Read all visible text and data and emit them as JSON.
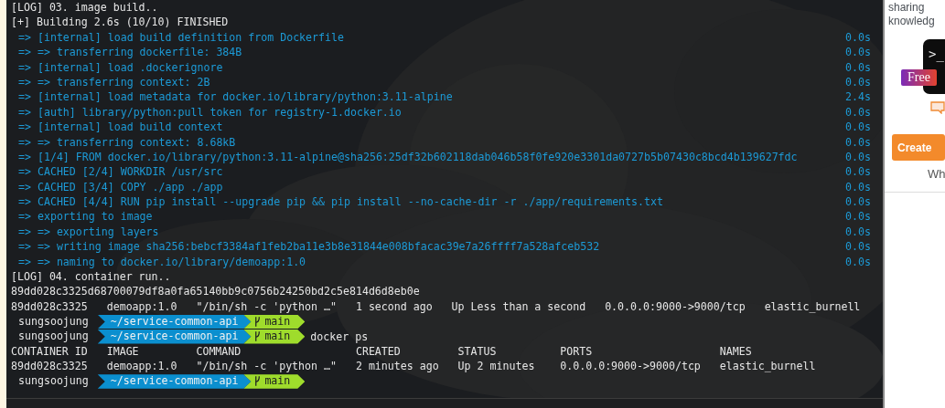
{
  "terminal": {
    "lines": [
      {
        "kind": "log",
        "text": "[LOG] 03. image build.."
      },
      {
        "kind": "log",
        "text": "[+] Building 2.6s (10/10) FINISHED"
      },
      {
        "kind": "step",
        "text": "=> [internal] load build definition from Dockerfile",
        "time": "0.0s"
      },
      {
        "kind": "step",
        "text": "=> => transferring dockerfile: 384B",
        "time": "0.0s"
      },
      {
        "kind": "step",
        "text": "=> [internal] load .dockerignore",
        "time": "0.0s"
      },
      {
        "kind": "step",
        "text": "=> => transferring context: 2B",
        "time": "0.0s"
      },
      {
        "kind": "step",
        "text": "=> [internal] load metadata for docker.io/library/python:3.11-alpine",
        "time": "2.4s"
      },
      {
        "kind": "step",
        "text": "=> [auth] library/python:pull token for registry-1.docker.io",
        "time": "0.0s"
      },
      {
        "kind": "step",
        "text": "=> [internal] load build context",
        "time": "0.0s"
      },
      {
        "kind": "step",
        "text": "=> => transferring context: 8.68kB",
        "time": "0.0s"
      },
      {
        "kind": "step",
        "text": "=> [1/4] FROM docker.io/library/python:3.11-alpine@sha256:25df32b602118dab046b58f0fe920e3301da0727b5b07430c8bcd4b139627fdc",
        "time": "0.0s"
      },
      {
        "kind": "step",
        "text": "=> CACHED [2/4] WORKDIR /usr/src",
        "time": "0.0s"
      },
      {
        "kind": "step",
        "text": "=> CACHED [3/4] COPY ./app ./app",
        "time": "0.0s"
      },
      {
        "kind": "step",
        "text": "=> CACHED [4/4] RUN pip install --upgrade pip && pip install --no-cache-dir -r ./app/requirements.txt",
        "time": "0.0s"
      },
      {
        "kind": "step",
        "text": "=> exporting to image",
        "time": "0.0s"
      },
      {
        "kind": "step",
        "text": "=> => exporting layers",
        "time": "0.0s"
      },
      {
        "kind": "step",
        "text": "=> => writing image sha256:bebcf3384af1feb2ba11e3b8e31844e008bfacac39e7a26ffff7a528afceb532",
        "time": "0.0s"
      },
      {
        "kind": "step",
        "text": "=> => naming to docker.io/library/demoapp:1.0",
        "time": "0.0s"
      },
      {
        "kind": "log",
        "text": "[LOG] 04. container run.."
      },
      {
        "kind": "output",
        "text": "89dd028c3325d68700079df8a0fa65140bb9c0756b24250bd2c5e814d6d8eb0e"
      },
      {
        "kind": "output",
        "text": "89dd028c3325   demoapp:1.0   \"/bin/sh -c 'python …\"   1 second ago   Up Less than a second   0.0.0.0:9000->9000/tcp   elastic_burnell"
      },
      {
        "kind": "prompt",
        "user": "sungsoojung",
        "path": "~/service-common-api",
        "branch": "main"
      },
      {
        "kind": "prompt",
        "user": "sungsoojung",
        "path": "~/service-common-api",
        "branch": "main",
        "command": "docker ps"
      },
      {
        "kind": "output",
        "text": "CONTAINER ID   IMAGE         COMMAND                  CREATED         STATUS          PORTS                    NAMES"
      },
      {
        "kind": "output",
        "text": "89dd028c3325   demoapp:1.0   \"/bin/sh -c 'python …\"   2 minutes ago   Up 2 minutes    0.0.0.0:9000->9000/tcp   elastic_burnell"
      },
      {
        "kind": "prompt",
        "user": "sungsoojung",
        "path": "~/service-common-api",
        "branch": "main"
      }
    ]
  },
  "sidebar": {
    "intro": [
      "sharing",
      "knowledg"
    ],
    "card": {
      "logo": ">_",
      "badge": "Free"
    },
    "button": "Create",
    "note": "Wh"
  }
}
